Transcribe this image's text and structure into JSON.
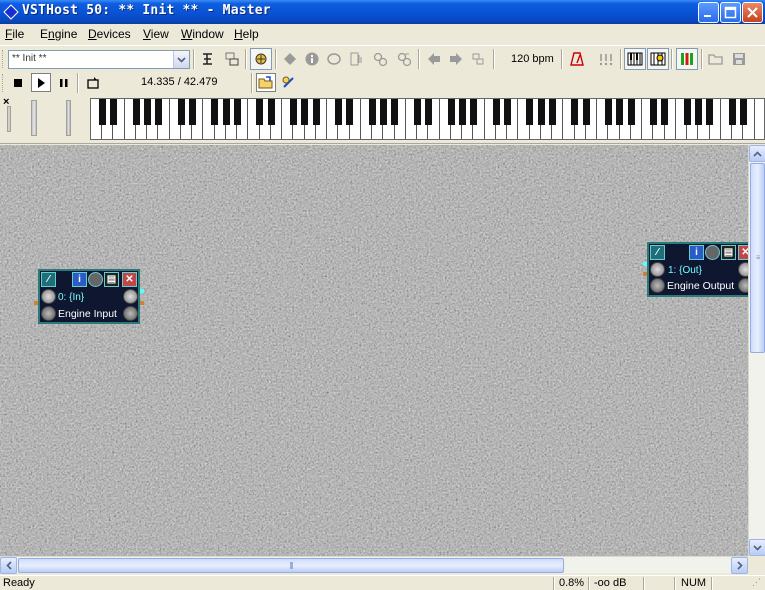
{
  "window": {
    "title": "VSTHost 50: ** Init ** - Master",
    "controls": [
      "minimize",
      "maximize",
      "close"
    ]
  },
  "menu": [
    {
      "label": "File",
      "mnemonic": "F",
      "rest": "ile"
    },
    {
      "label": "Engine",
      "mnemonic": "n",
      "pre": "E",
      "rest": "gine"
    },
    {
      "label": "Devices",
      "mnemonic": "D",
      "rest": "evices"
    },
    {
      "label": "View",
      "mnemonic": "V",
      "rest": "iew"
    },
    {
      "label": "Window",
      "mnemonic": "W",
      "rest": "indow"
    },
    {
      "label": "Help",
      "mnemonic": "H",
      "rest": "elp"
    }
  ],
  "toolbar": {
    "performance_select": "** Init **",
    "bpm": "120 bpm",
    "time_position": "14.335 / 42.479",
    "icons": [
      "plugin-icon",
      "chain-icon",
      "engine-icon",
      "diamond-icon",
      "info-icon",
      "speech-icon",
      "edit-icon",
      "midi-icon",
      "midi-thru-icon",
      "back-icon",
      "forward-icon",
      "bank-icon",
      "metronome-icon",
      "triplet-icon",
      "keyboard-icon",
      "controller-icon",
      "levels-icon",
      "open-icon",
      "save-icon"
    ]
  },
  "transport": {
    "buttons": [
      "stop",
      "play",
      "pause",
      "loop"
    ],
    "actions": [
      "open-file",
      "record"
    ]
  },
  "keyboard": {
    "close_label": "×",
    "white_keys": 60
  },
  "nodes": [
    {
      "id": "engine-input",
      "number": "0: {In}",
      "name": "Engine Input"
    },
    {
      "id": "engine-output",
      "number": "1: {Out}",
      "name": "Engine Output"
    }
  ],
  "status": {
    "text": "Ready",
    "cpu": "0.8%",
    "level": "-oo dB",
    "num": "NUM"
  },
  "colors": {
    "title_bar": "#0a54d6",
    "canvas": "#4a4a4a",
    "node_border": "#2b7a7a",
    "node_bg": "#0e1630",
    "node_number": "#77ffff"
  }
}
